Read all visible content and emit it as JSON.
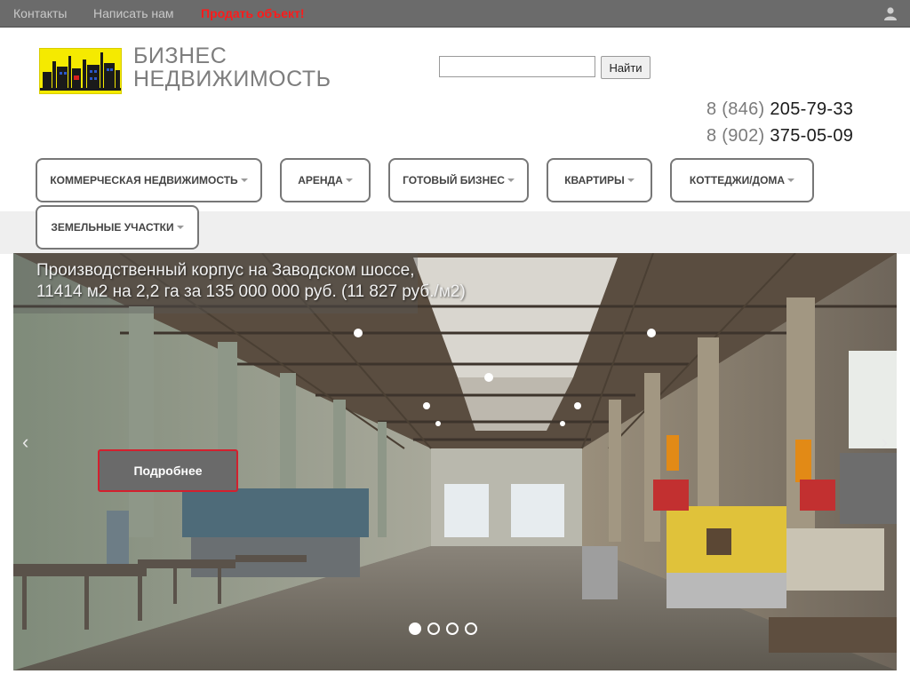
{
  "topbar": {
    "links": [
      "Контакты",
      "Написать нам"
    ],
    "sell_label": "Продать объект!",
    "user_icon": "user-icon"
  },
  "header": {
    "brand_line1": "БИЗНЕС",
    "brand_line2": "НЕДВИЖИМОСТЬ",
    "search_placeholder": "",
    "search_button": "Найти",
    "phones": [
      {
        "code": "8 (846)",
        "number": "205-79-33"
      },
      {
        "code": "8 (902)",
        "number": "375-05-09"
      }
    ]
  },
  "nav": {
    "items": [
      {
        "label": "Коммерческая недвижимость"
      },
      {
        "label": "Аренда"
      },
      {
        "label": "Готовый бизнес"
      },
      {
        "label": "Квартиры"
      },
      {
        "label": "Коттеджи/Дома"
      },
      {
        "label": "Земельные участки"
      }
    ]
  },
  "slider": {
    "caption_line1": "Производственный корпус на Заводском шоссе,",
    "caption_line2": "11414 м2 на 2,2 га за 135 000 000 руб. (11 827 руб./м2)",
    "more_label": "Подробнее",
    "prev_icon": "‹",
    "next_icon": "›",
    "slides_count": 4,
    "active_slide": 1
  },
  "colors": {
    "topbar_bg": "#6b6b6b",
    "sell_accent": "#ff1a1a",
    "logo_yellow": "#f5ea00",
    "more_border": "#d3202e"
  }
}
